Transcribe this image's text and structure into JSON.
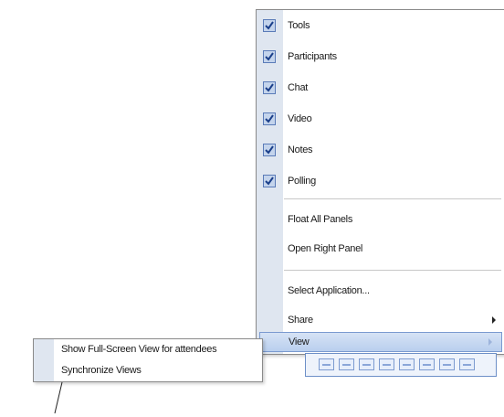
{
  "main_menu": {
    "checked_items": [
      {
        "label": "Tools",
        "checked": true
      },
      {
        "label": "Participants",
        "checked": true
      },
      {
        "label": "Chat",
        "checked": true
      },
      {
        "label": "Video",
        "checked": true
      },
      {
        "label": "Notes",
        "checked": true
      },
      {
        "label": "Polling",
        "checked": true
      }
    ],
    "panel_items": [
      {
        "label": "Float All Panels"
      },
      {
        "label": "Open Right Panel"
      }
    ],
    "app_items": [
      {
        "label": "Select Application..."
      },
      {
        "label": "Share",
        "submenu_icon": "chevron-right-icon"
      }
    ],
    "view_item": {
      "label": "View",
      "submenu_icon": "chevron-right-icon",
      "highlighted": true
    }
  },
  "view_submenu": {
    "items": [
      {
        "label": "Show Full-Screen View for attendees"
      },
      {
        "label": "Synchronize Views"
      }
    ]
  },
  "colors": {
    "gutter": "#dfe6f0",
    "check_fill": "#c4d4ec",
    "highlight": "#b9cfee",
    "toolbar_border": "#6d8fc7"
  }
}
